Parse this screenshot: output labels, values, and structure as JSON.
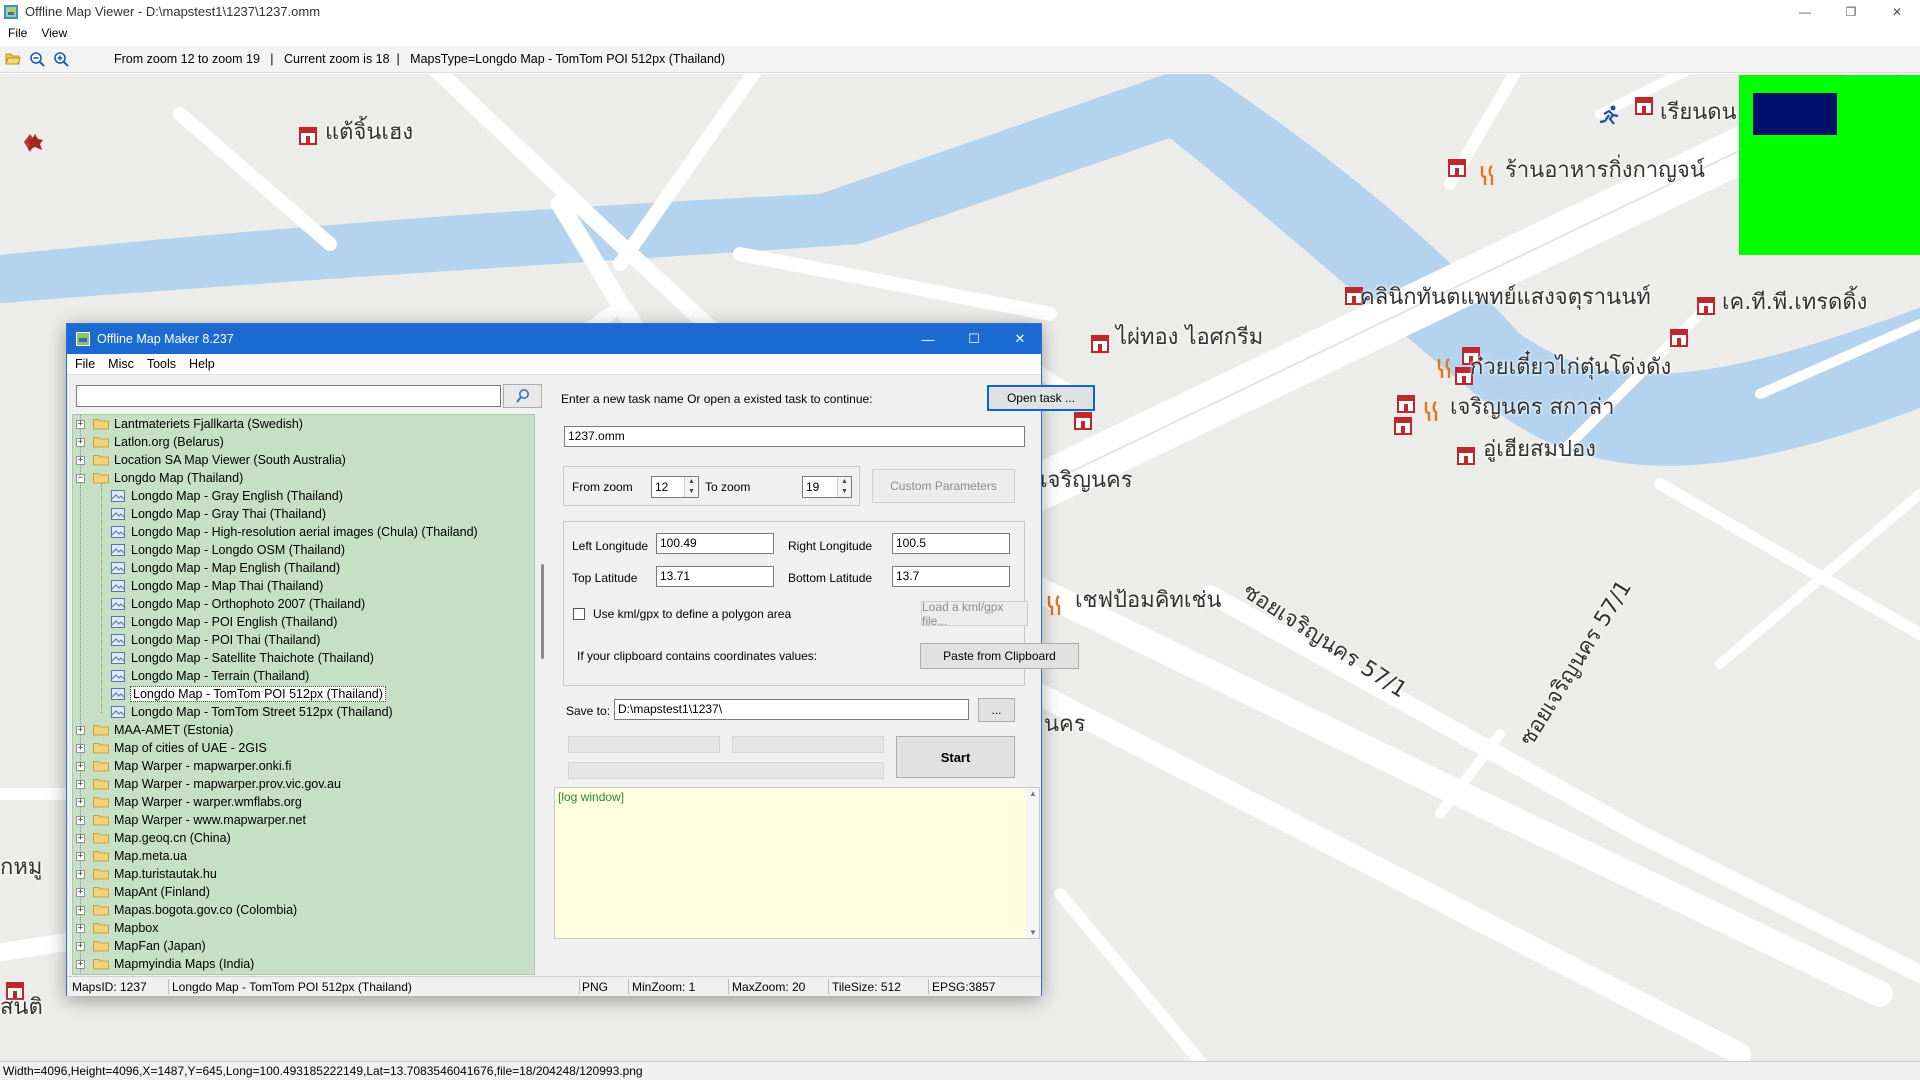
{
  "viewer": {
    "title": "Offline Map Viewer - D:\\mapstest1\\1237\\1237.omm",
    "menu": [
      "File",
      "View"
    ],
    "toolbar_info": "From zoom 12 to zoom 19   |   Current zoom is 18  |   MapsType=Longdo Map - TomTom POI 512px (Thailand)",
    "statusbar": "Width=4096,Height=4096,X=1487,Y=645,Long=100.493185222149,Lat=13.7083546041676,file=18/204248/120993.png"
  },
  "map_labels": [
    "แต้จิ้นเฮง",
    "เรียนดน",
    "ร้านอาหารกิ่งกาญจน์",
    "คลินิกทันตแพทย์แสงจตุรานนท์",
    "เค.ที.พี.เทรดดิ้ง",
    "ไผ่ทอง ไอศกรีม",
    "ก๋วยเตี๋ยวไก่ตุ๋นโด่งดัง",
    "เจริญนคร สกาล่า",
    "อู่เฮียสมปอง",
    "ซอยเจริญนคร 57/1",
    "ซอยเจริญนคร 57/1",
    "เชฟป้อมคิทเช่น",
    "เจริญนคร",
    "นคร",
    "กหมู",
    "สนติ"
  ],
  "maker": {
    "title": "Offline Map Maker 8.237",
    "menu": [
      "File",
      "Misc",
      "Tools",
      "Help"
    ],
    "search": {
      "value": ""
    },
    "tree": [
      {
        "label": "Lantmateriets Fjallkarta (Swedish)",
        "type": "folder",
        "expander": "+"
      },
      {
        "label": "Latlon.org (Belarus)",
        "type": "folder",
        "expander": "+"
      },
      {
        "label": "Location SA Map Viewer (South Australia)",
        "type": "folder",
        "expander": "+"
      },
      {
        "label": "Longdo Map (Thailand)",
        "type": "folder-open",
        "expander": "−"
      },
      {
        "label": "Longdo Map - Gray English (Thailand)",
        "type": "map"
      },
      {
        "label": "Longdo Map - Gray Thai (Thailand)",
        "type": "map"
      },
      {
        "label": "Longdo Map - High-resolution aerial images (Chula) (Thailand)",
        "type": "map"
      },
      {
        "label": "Longdo Map - Longdo OSM (Thailand)",
        "type": "map"
      },
      {
        "label": "Longdo Map - Map English (Thailand)",
        "type": "map"
      },
      {
        "label": "Longdo Map - Map Thai (Thailand)",
        "type": "map"
      },
      {
        "label": "Longdo Map - Orthophoto 2007 (Thailand)",
        "type": "map"
      },
      {
        "label": "Longdo Map - POI English (Thailand)",
        "type": "map"
      },
      {
        "label": "Longdo Map - POI Thai (Thailand)",
        "type": "map"
      },
      {
        "label": "Longdo Map - Satellite Thaichote (Thailand)",
        "type": "map"
      },
      {
        "label": "Longdo Map - Terrain (Thailand)",
        "type": "map"
      },
      {
        "label": "Longdo Map - TomTom POI 512px (Thailand)",
        "type": "map",
        "selected": true
      },
      {
        "label": "Longdo Map - TomTom Street 512px (Thailand)",
        "type": "map"
      },
      {
        "label": "MAA-AMET (Estonia)",
        "type": "folder",
        "expander": "+"
      },
      {
        "label": "Map of cities of UAE - 2GIS",
        "type": "folder",
        "expander": "+"
      },
      {
        "label": "Map Warper - mapwarper.onki.fi",
        "type": "folder",
        "expander": "+"
      },
      {
        "label": "Map Warper - mapwarper.prov.vic.gov.au",
        "type": "folder",
        "expander": "+"
      },
      {
        "label": "Map Warper - warper.wmflabs.org",
        "type": "folder",
        "expander": "+"
      },
      {
        "label": "Map Warper - www.mapwarper.net",
        "type": "folder",
        "expander": "+"
      },
      {
        "label": "Map.geoq.cn (China)",
        "type": "folder",
        "expander": "+"
      },
      {
        "label": "Map.meta.ua",
        "type": "folder",
        "expander": "+"
      },
      {
        "label": "Map.turistautak.hu",
        "type": "folder",
        "expander": "+"
      },
      {
        "label": "MapAnt (Finland)",
        "type": "folder",
        "expander": "+"
      },
      {
        "label": "Mapas.bogota.gov.co (Colombia)",
        "type": "folder",
        "expander": "+"
      },
      {
        "label": "Mapbox",
        "type": "folder",
        "expander": "+"
      },
      {
        "label": "MapFan (Japan)",
        "type": "folder",
        "expander": "+"
      },
      {
        "label": "Mapmyindia Maps (India)",
        "type": "folder",
        "expander": "+"
      }
    ],
    "task_prompt": "Enter a new task name Or open a existed task to continue:",
    "open_task_label": "Open task ...",
    "task_name": "1237.omm",
    "from_zoom_label": "From zoom",
    "from_zoom": "12",
    "to_zoom_label": "To zoom",
    "to_zoom": "19",
    "custom_params_label": "Custom Parameters",
    "left_lon_label": "Left Longitude",
    "left_lon": "100.49",
    "right_lon_label": "Right Longitude",
    "right_lon": "100.5",
    "top_lat_label": "Top Latitude",
    "top_lat": "13.71",
    "bottom_lat_label": "Bottom Latitude",
    "bottom_lat": "13.7",
    "kml_label": "Use kml/gpx to define a polygon area",
    "load_kml_label": "Load a kml/gpx file...",
    "clipboard_label": "If your clipboard contains coordinates values:",
    "paste_label": "Paste from Clipboard",
    "save_to_label": "Save to:",
    "save_to": "D:\\mapstest1\\1237\\",
    "browse_label": "...",
    "start_label": "Start",
    "log_text": "[log window]",
    "status": {
      "maps_id": "MapsID: 1237",
      "maps_name": "Longdo Map - TomTom POI 512px (Thailand)",
      "format": "PNG",
      "min_zoom": "MinZoom: 1",
      "max_zoom": "MaxZoom: 20",
      "tile_size": "TileSize: 512",
      "epsg": "EPSG:3857"
    }
  },
  "colors": {
    "map_bg": "#ececea",
    "road": "#ffffff",
    "water": "#b3d3ee",
    "tree_bg": "#c5e0c5",
    "minimap": "#00ff00",
    "minimap_view": "#00106b",
    "title_blue": "#1b6ad1",
    "poi_red": "#c0272d",
    "food_orange": "#e8741c"
  }
}
